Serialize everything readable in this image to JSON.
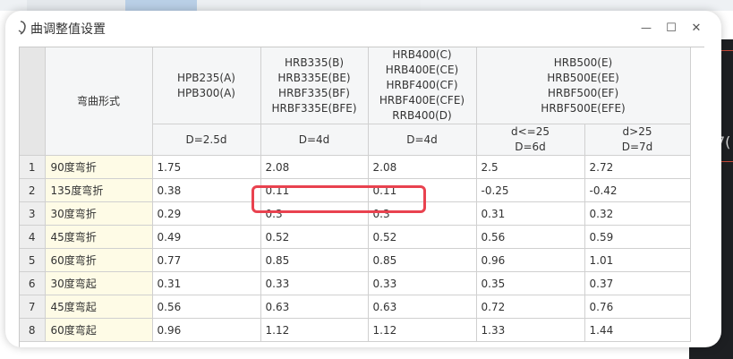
{
  "window": {
    "title": "曲调整值设置",
    "controls": {
      "minimize": "—",
      "maximize": "☐",
      "close": "✕"
    }
  },
  "background": {
    "partial_glyph": "7("
  },
  "table": {
    "corner_label": "",
    "bend_type_header": "弯曲形式",
    "groups": [
      {
        "name": "HPB235(A)\nHPB300(A)"
      },
      {
        "name": "HRB335(B)\nHRB335E(BE)\nHRBF335(BF)\nHRBF335E(BFE)"
      },
      {
        "name": "HRB400(C)\nHRB400E(CE)\nHRBF400(CF)\nHRBF400E(CFE)\nRRB400(D)"
      },
      {
        "name": "HRB500(E)\nHRB500E(EE)\nHRBF500(EF)\nHRBF500E(EFE)"
      }
    ],
    "subheaders": [
      "D=2.5d",
      "D=4d",
      "D=4d",
      "d<=25\nD=6d",
      "d>25\nD=7d"
    ],
    "rows": [
      {
        "num": "1",
        "type": "90度弯折",
        "values": [
          "1.75",
          "2.08",
          "2.08",
          "2.5",
          "2.72"
        ]
      },
      {
        "num": "2",
        "type": "135度弯折",
        "values": [
          "0.38",
          "0.11",
          "0.11",
          "-0.25",
          "-0.42"
        ]
      },
      {
        "num": "3",
        "type": "30度弯折",
        "values": [
          "0.29",
          "0.3",
          "0.3",
          "0.31",
          "0.32"
        ]
      },
      {
        "num": "4",
        "type": "45度弯折",
        "values": [
          "0.49",
          "0.52",
          "0.52",
          "0.56",
          "0.59"
        ]
      },
      {
        "num": "5",
        "type": "60度弯折",
        "values": [
          "0.77",
          "0.85",
          "0.85",
          "0.96",
          "1.01"
        ]
      },
      {
        "num": "6",
        "type": "30度弯起",
        "values": [
          "0.31",
          "0.33",
          "0.33",
          "0.35",
          "0.37"
        ]
      },
      {
        "num": "7",
        "type": "45度弯起",
        "values": [
          "0.56",
          "0.63",
          "0.63",
          "0.72",
          "0.76"
        ]
      },
      {
        "num": "8",
        "type": "60度弯起",
        "values": [
          "0.96",
          "1.12",
          "1.12",
          "1.33",
          "1.44"
        ]
      }
    ]
  },
  "colors": {
    "highlight": "#e9424f",
    "category_bg": "#fefbe6",
    "header_bg": "#f5f6f7"
  }
}
